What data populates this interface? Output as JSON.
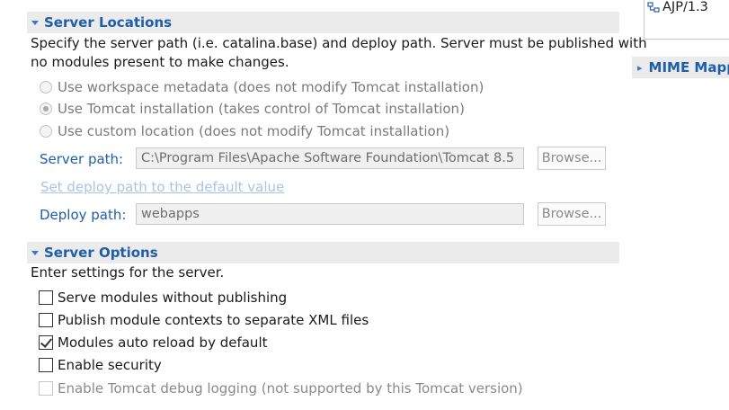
{
  "server_locations": {
    "title": "Server Locations",
    "description_line1": "Specify the server path (i.e. catalina.base) and deploy path. Server must be published with",
    "description_line2": "no modules present to make changes.",
    "radio_options": [
      {
        "label": "Use workspace metadata (does not modify Tomcat installation)",
        "checked": false
      },
      {
        "label": "Use Tomcat installation (takes control of Tomcat installation)",
        "checked": true
      },
      {
        "label": "Use custom location (does not modify Tomcat installation)",
        "checked": false
      }
    ],
    "server_path_label": "Server path:",
    "server_path_value": "C:\\Program Files\\Apache Software Foundation\\Tomcat 8.5",
    "browse_label": "Browse...",
    "set_deploy_link": "Set deploy path to the default value",
    "deploy_path_label": "Deploy path:",
    "deploy_path_value": "webapps"
  },
  "server_options": {
    "title": "Server Options",
    "description": "Enter settings for the server.",
    "checkboxes": [
      {
        "label": "Serve modules without publishing",
        "checked": false,
        "enabled": true
      },
      {
        "label": "Publish module contexts to separate XML files",
        "checked": false,
        "enabled": true
      },
      {
        "label": "Modules auto reload by default",
        "checked": true,
        "enabled": true
      },
      {
        "label": "Enable security",
        "checked": false,
        "enabled": true
      },
      {
        "label": "Enable Tomcat debug logging (not supported by this Tomcat version)",
        "checked": false,
        "enabled": false
      }
    ]
  },
  "right_panel": {
    "ports_item": "AJP/1.3",
    "mime_title": "MIME Mappings"
  },
  "colors": {
    "accent": "#1f5fa8",
    "header_bg": "#ebebeb"
  }
}
